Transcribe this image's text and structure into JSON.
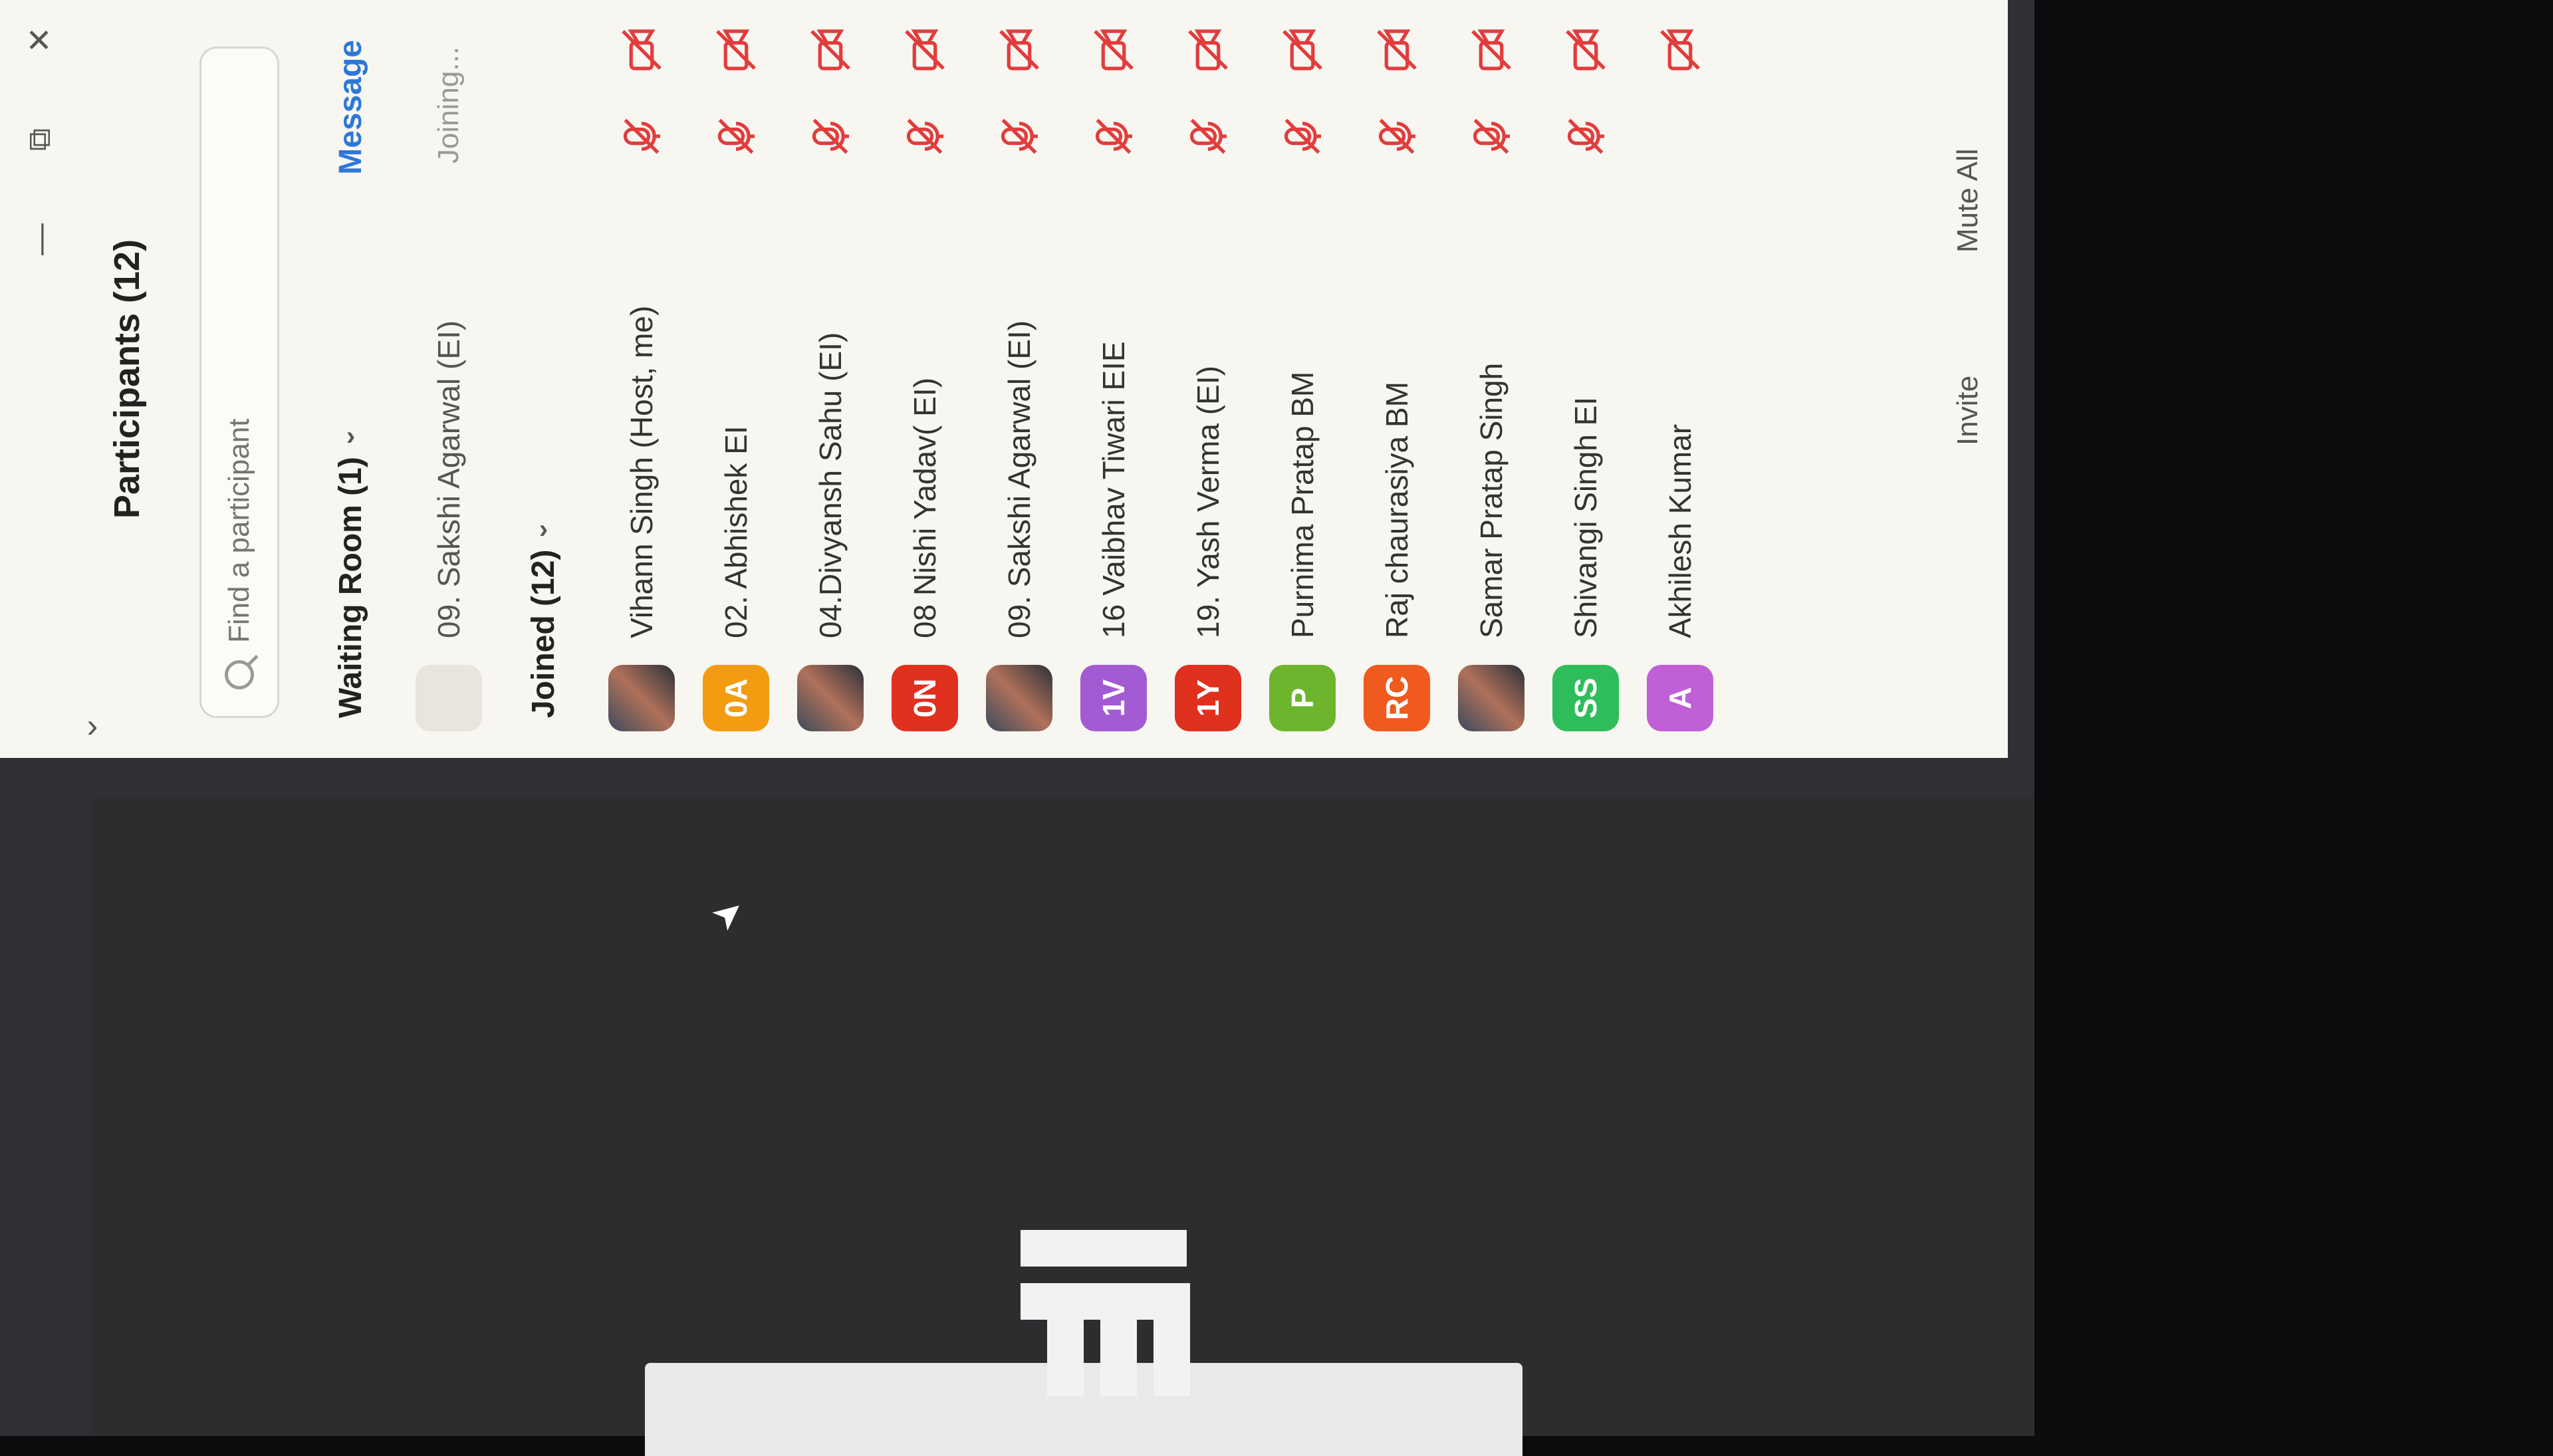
{
  "panel": {
    "title": "Participants (12)",
    "search_placeholder": "Find a participant",
    "waiting_room": {
      "header": "Waiting Room (1)",
      "message_label": "Message",
      "participants": [
        {
          "name": "09. Sakshi Agarwal (EI)",
          "status": "Joining..."
        }
      ]
    },
    "joined": {
      "header": "Joined (12)",
      "participants": [
        {
          "name": "Vihann Singh (Host, me)",
          "initials": "",
          "avatar": "photo",
          "color": "#3c4a5c"
        },
        {
          "name": "02. Abhishek EI",
          "initials": "0A",
          "avatar": "initials",
          "color": "#f39c12"
        },
        {
          "name": "04.Divyansh Sahu (EI)",
          "initials": "",
          "avatar": "photo",
          "color": "#c9754a"
        },
        {
          "name": "08 Nishi Yadav( EI)",
          "initials": "0N",
          "avatar": "initials",
          "color": "#e0301e"
        },
        {
          "name": "09. Sakshi Agarwal (EI)",
          "initials": "",
          "avatar": "photo",
          "color": "#8a3b2a"
        },
        {
          "name": "16 Vaibhav Tiwari EIE",
          "initials": "1V",
          "avatar": "initials",
          "color": "#a35bd3"
        },
        {
          "name": "19. Yash Verma (EI)",
          "initials": "1Y",
          "avatar": "initials",
          "color": "#e0301e"
        },
        {
          "name": "Purnima Pratap BM",
          "initials": "P",
          "avatar": "initials",
          "color": "#6cb52d"
        },
        {
          "name": "Raj chaurasiya BM",
          "initials": "RC",
          "avatar": "initials",
          "color": "#f05a1e"
        },
        {
          "name": "Samar Pratap Singh",
          "initials": "",
          "avatar": "photo",
          "color": "#3a5a8c"
        },
        {
          "name": "Shivangi Singh EI",
          "initials": "SS",
          "avatar": "initials",
          "color": "#2ebd5a"
        },
        {
          "name": "Akhilesh Kumar",
          "initials": "A",
          "avatar": "initials",
          "color": "#c05fd6"
        }
      ]
    },
    "bottom": {
      "invite": "Invite",
      "mute_all": "Mute All",
      "more": "..."
    }
  },
  "meeting": {
    "logo_text": "EI"
  }
}
